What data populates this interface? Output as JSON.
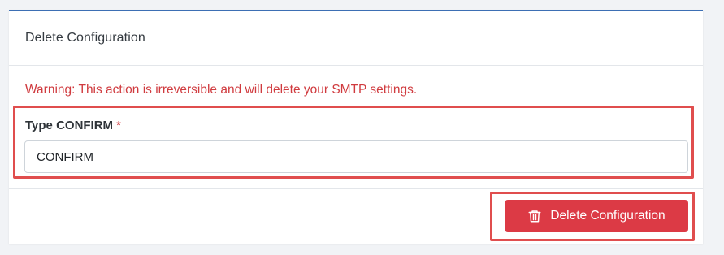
{
  "card": {
    "title": "Delete Configuration"
  },
  "warning": {
    "text": "Warning: This action is irreversible and will delete your SMTP settings."
  },
  "confirm_field": {
    "label": "Type CONFIRM",
    "required_marker": "*",
    "value": "CONFIRM"
  },
  "footer": {
    "delete_button_label": "Delete Configuration",
    "delete_button_icon": "trash-icon"
  },
  "colors": {
    "accent_top_border": "#3d6fb4",
    "danger": "#dc3a45",
    "warning_text": "#d03b3f",
    "highlight_outline": "#e04e4e"
  }
}
